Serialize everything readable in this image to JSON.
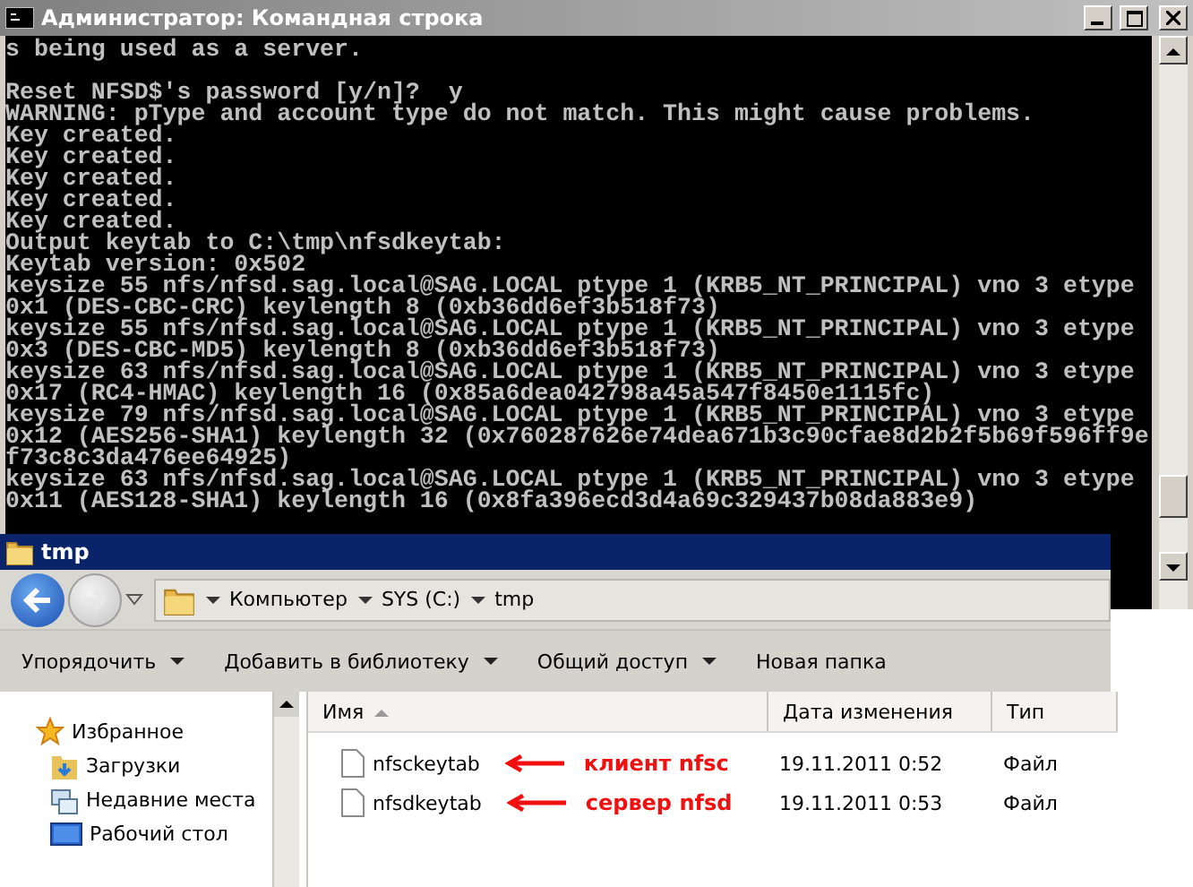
{
  "console": {
    "title": "Администратор: Командная строка",
    "paragraphs": [
      [
        "s being used as a server."
      ],
      [
        "Reset NFSD$'s password [y/n]?  y",
        "WARNING: pType and account type do not match. This might cause problems.",
        "Key created.",
        "Key created.",
        "Key created.",
        "Key created.",
        "Key created.",
        "Output keytab to C:\\tmp\\nfsdkeytab:",
        "Keytab version: 0x502",
        "keysize 55 nfs/nfsd.sag.local@SAG.LOCAL ptype 1 (KRB5_NT_PRINCIPAL) vno 3 etype",
        "0x1 (DES-CBC-CRC) keylength 8 (0xb36dd6ef3b518f73)",
        "keysize 55 nfs/nfsd.sag.local@SAG.LOCAL ptype 1 (KRB5_NT_PRINCIPAL) vno 3 etype",
        "0x3 (DES-CBC-MD5) keylength 8 (0xb36dd6ef3b518f73)",
        "keysize 63 nfs/nfsd.sag.local@SAG.LOCAL ptype 1 (KRB5_NT_PRINCIPAL) vno 3 etype",
        "0x17 (RC4-HMAC) keylength 16 (0x85a6dea042798a45a547f8450e1115fc)",
        "keysize 79 nfs/nfsd.sag.local@SAG.LOCAL ptype 1 (KRB5_NT_PRINCIPAL) vno 3 etype",
        "0x12 (AES256-SHA1) keylength 32 (0x760287626e74dea671b3c90cfae8d2b2f5b69f596ff9e",
        "f73c8c3da476ee64925)",
        "keysize 63 nfs/nfsd.sag.local@SAG.LOCAL ptype 1 (KRB5_NT_PRINCIPAL) vno 3 etype",
        "0x11 (AES128-SHA1) keylength 16 (0x8fa396ecd3d4a69c329437b08da883e9)"
      ]
    ]
  },
  "explorer": {
    "title": "tmp",
    "breadcrumbs": [
      "Компьютер",
      "SYS (C:)",
      "tmp"
    ],
    "toolbar": [
      {
        "label": "Упорядочить",
        "dropdown": true
      },
      {
        "label": "Добавить в библиотеку",
        "dropdown": true
      },
      {
        "label": "Общий доступ",
        "dropdown": true
      },
      {
        "label": "Новая папка",
        "dropdown": false
      }
    ],
    "nav_pane": {
      "header": "Избранное",
      "items": [
        {
          "label": "Загрузки",
          "kind": "downloads"
        },
        {
          "label": "Недавние места",
          "kind": "recent"
        },
        {
          "label": "Рабочий стол",
          "kind": "desktop"
        }
      ]
    },
    "columns": [
      {
        "label": "Имя",
        "sorted": true
      },
      {
        "label": "Дата изменения",
        "sorted": false
      },
      {
        "label": "Тип",
        "sorted": false
      }
    ],
    "files": [
      {
        "name": "nfsckeytab",
        "modified": "19.11.2011 0:52",
        "type": "Файл",
        "annotation": "клиент  nfsc"
      },
      {
        "name": "nfsdkeytab",
        "modified": "19.11.2011 0:53",
        "type": "Файл",
        "annotation": "сервер nfsd"
      }
    ]
  }
}
